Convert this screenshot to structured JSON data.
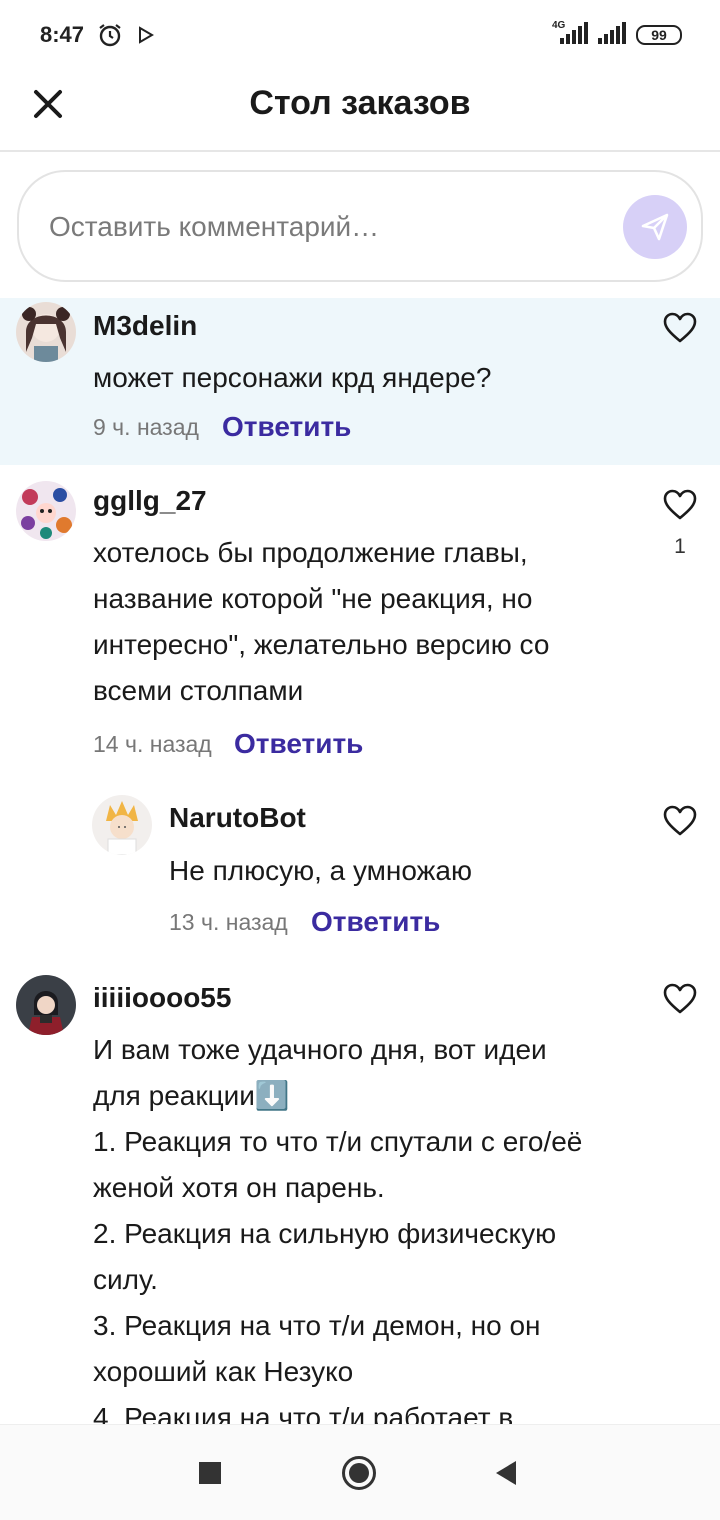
{
  "status_bar": {
    "time": "8:47",
    "network": "4G",
    "battery": "99",
    "icons": [
      "alarm-icon",
      "play-store-icon",
      "signal-icon",
      "signal-icon",
      "battery-icon"
    ]
  },
  "header": {
    "title": "Стол заказов",
    "close_icon": "close-icon"
  },
  "composer": {
    "placeholder": "Оставить комментарий…",
    "send_icon": "send-icon",
    "send_color": "#d7d0f7"
  },
  "comments": [
    {
      "username": "M3delin",
      "text": "может персонажи крд яндере?",
      "time": "9 ч. назад",
      "reply": "Ответить",
      "likes": ""
    },
    {
      "username": "ggllg_27",
      "text": "хотелось бы продолжение главы,\nназвание которой \"не реакция, но\nинтересно\", желательно версию со\nвсеми столпами",
      "time": "14 ч. назад",
      "reply": "Ответить",
      "likes": "1",
      "replies": [
        {
          "username": "NarutoBot",
          "text": "Не плюсую, а умножаю",
          "time": "13 ч. назад",
          "reply": "Ответить",
          "likes": ""
        }
      ]
    },
    {
      "username": "iiiiioooo55",
      "text": "И вам тоже удачного дня, вот идеи\nдля реакции⬇️\n1. Реакция то что т/и спутали с его/её\nженой хотя он парень.\n2. Реакция на сильную физическую\nсилу.\n3. Реакция на что т/и демон, но он\nхороший как Незуко\n4. Реакция на что т/и работает в",
      "time": "",
      "reply": "",
      "likes": ""
    }
  ],
  "colors": {
    "accent": "#3b2ba0",
    "highlight_bg": "#eef7fb"
  },
  "nav": {
    "icons": [
      "recent-apps-icon",
      "home-icon",
      "back-icon"
    ]
  }
}
